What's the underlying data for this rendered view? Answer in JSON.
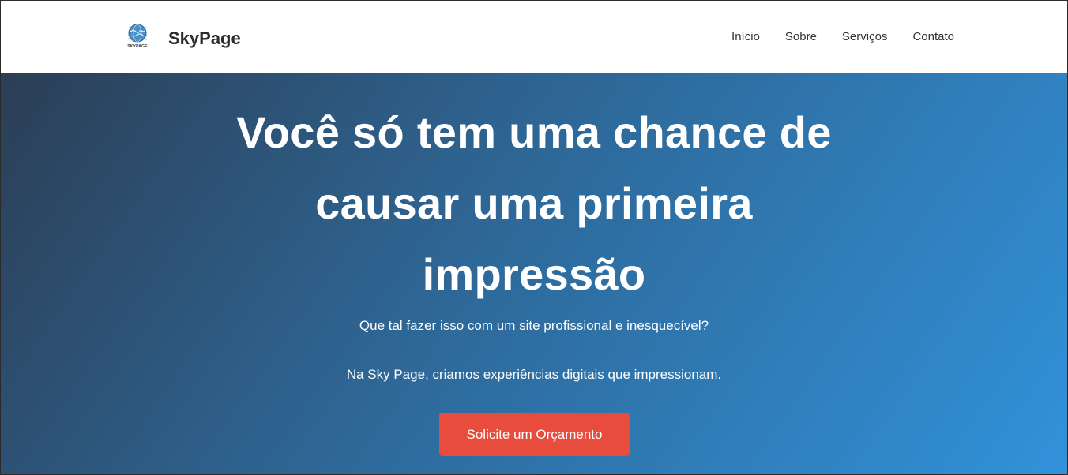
{
  "brand": {
    "logo_text": "SKYPAGE",
    "name": "SkyPage"
  },
  "nav": {
    "items": [
      "Início",
      "Sobre",
      "Serviços",
      "Contato"
    ]
  },
  "hero": {
    "title": "Você só tem uma chance de causar uma primeira impressão",
    "subtitle_1": "Que tal fazer isso com um site profissional e inesquecível?",
    "subtitle_2": "Na Sky Page, criamos experiências digitais que impressionam.",
    "cta_label": "Solicite um Orçamento"
  },
  "colors": {
    "cta": "#e74c3c",
    "gradient_start": "#2c3e55",
    "gradient_end": "#3192da"
  }
}
